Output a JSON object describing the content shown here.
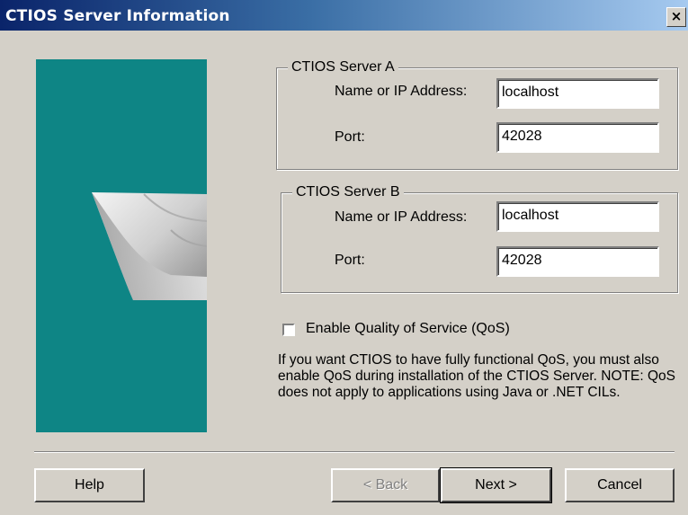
{
  "window": {
    "title": "CTIOS Server Information",
    "close_glyph": "×"
  },
  "server_a": {
    "legend": "CTIOS Server A",
    "name_label": "Name or IP Address:",
    "name_value": "localhost",
    "port_label": "Port:",
    "port_value": "42028"
  },
  "server_b": {
    "legend": "CTIOS Server B",
    "name_label": "Name or IP Address:",
    "name_value": "localhost",
    "port_label": "Port:",
    "port_value": "42028"
  },
  "qos": {
    "checkbox_label": "Enable Quality of Service (QoS)",
    "checked": false,
    "info_text": "If you want CTIOS to have fully functional QoS, you must also enable QoS during installation of the CTIOS Server. NOTE: QoS does not apply to applications using Java or .NET CILs."
  },
  "buttons": {
    "help": "Help",
    "back": "< Back",
    "next": "Next >",
    "cancel": "Cancel"
  },
  "colors": {
    "panel": "#0e8585",
    "title_gradient_start": "#0a246a",
    "dialog_bg": "#d4d0c8"
  }
}
